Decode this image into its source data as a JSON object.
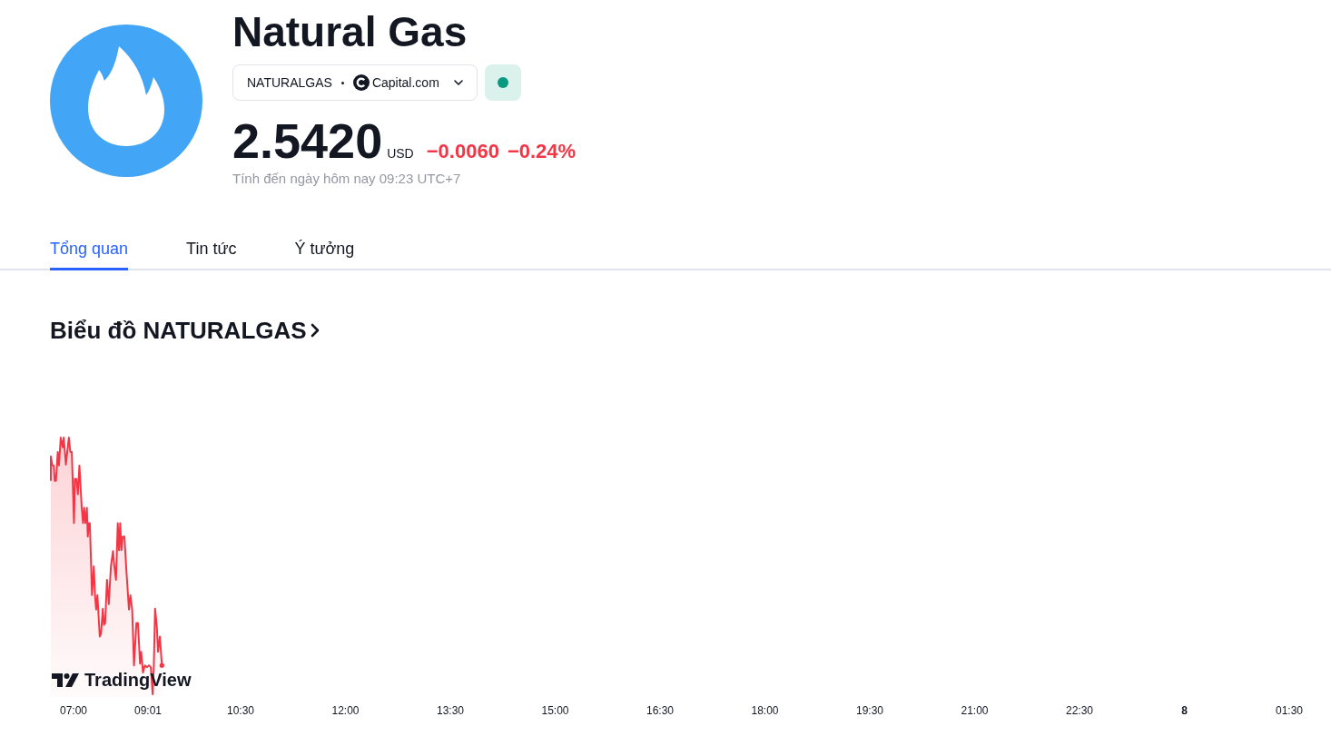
{
  "instrument": {
    "name": "Natural Gas",
    "symbol": {
      "ticker": "NATURALGAS",
      "exchange": "Capital.com",
      "market_open": true
    },
    "quote": {
      "price": "2.5420",
      "currency": "USD",
      "change": "−0.0060",
      "change_percent": "−0.24%",
      "falling": true,
      "as_of": "Tính đến ngày hôm nay 09:23 UTC+7"
    }
  },
  "tabs": [
    {
      "label": "Tổng quan",
      "selected": true
    },
    {
      "label": "Tin tức",
      "selected": false
    },
    {
      "label": "Ý tưởng",
      "selected": false
    }
  ],
  "chart": {
    "heading": "Biểu đồ NATURALGAS",
    "attribution": "TradingView",
    "time_labels": [
      {
        "text": "07:00",
        "kind": "time"
      },
      {
        "text": "09:01",
        "kind": "time"
      },
      {
        "text": "10:30",
        "kind": "time"
      },
      {
        "text": "12:00",
        "kind": "time"
      },
      {
        "text": "13:30",
        "kind": "time"
      },
      {
        "text": "15:00",
        "kind": "time"
      },
      {
        "text": "16:30",
        "kind": "time"
      },
      {
        "text": "18:00",
        "kind": "time"
      },
      {
        "text": "19:30",
        "kind": "time"
      },
      {
        "text": "21:00",
        "kind": "time"
      },
      {
        "text": "22:30",
        "kind": "time"
      },
      {
        "text": "8",
        "kind": "day"
      },
      {
        "text": "01:30",
        "kind": "time"
      }
    ]
  }
}
